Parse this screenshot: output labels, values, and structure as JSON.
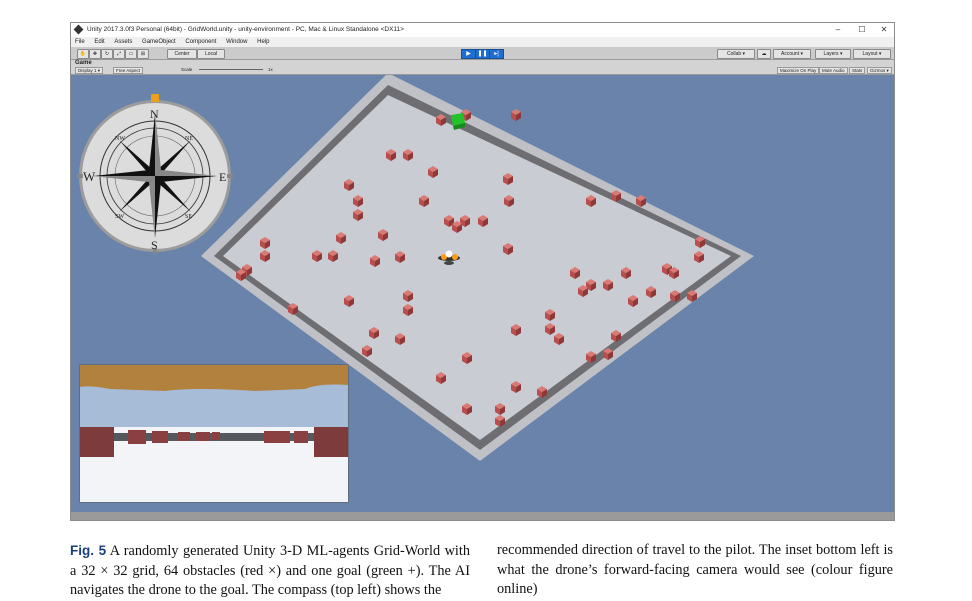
{
  "window": {
    "title": "Unity 2017.3.0f3 Personal (64bit) - GridWorld.unity - unity-environment - PC, Mac & Linux Standalone <DX11>",
    "controls": [
      "–",
      "☐",
      "✕"
    ]
  },
  "menu": [
    "File",
    "Edit",
    "Assets",
    "GameObject",
    "Component",
    "Window",
    "Help"
  ],
  "toolbar": {
    "pivot_label": "Center",
    "space_label": "Local",
    "collab_label": "Collab ▾",
    "account_label": "Account ▾",
    "layers_label": "Layers ▾",
    "layout_label": "Layout ▾"
  },
  "game_view": {
    "tab_label": "Game",
    "display_label": "Display 1 ▾",
    "aspect_label": "Free Aspect",
    "scale_label": "Scale",
    "scale_value": "1x",
    "options": [
      "Maximize On Play",
      "Mute Audio",
      "Stats",
      "Gizmos ▾"
    ]
  },
  "compass": {
    "north": "N",
    "south": "S",
    "east": "E",
    "west": "W",
    "northeast": "NE",
    "northwest": "NW",
    "southeast": "SE",
    "southwest": "SW"
  },
  "colors": {
    "sky": "#6a83ab",
    "floor": "#c9ccd2",
    "wall": "#d9d9d9",
    "obstacle": "#b94e4e",
    "goal": "#22c22a",
    "fig_label": "#1a3f7a"
  },
  "caption": {
    "label": "Fig. 5",
    "left_text": "A randomly generated Unity 3-D ML-agents Grid-World with a 32 × 32 grid, 64 obstacles (red ×) and one goal (green +). The AI navigates the drone to the goal. The compass (top left) shows the",
    "right_text": "recommended direction of travel to the pilot. The inset bottom left is what the drone’s forward-facing camera would see (colour figure online)"
  }
}
